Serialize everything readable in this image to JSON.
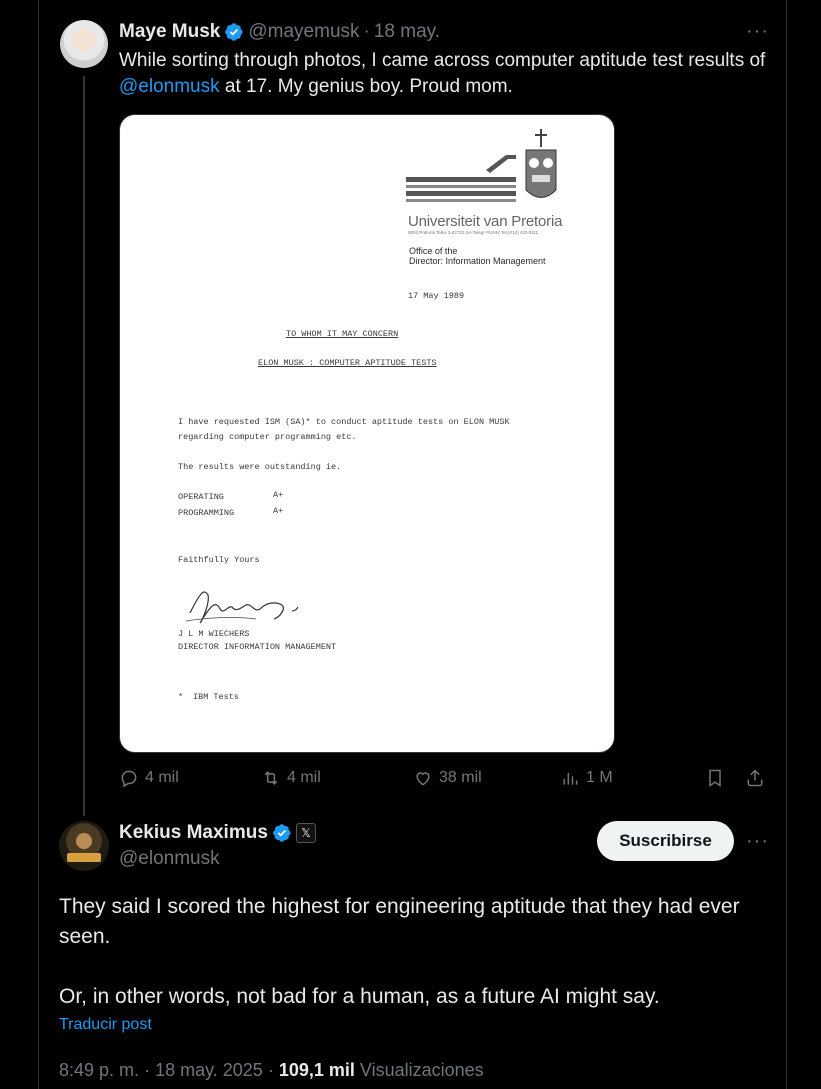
{
  "colors": {
    "background": "#000000",
    "accent": "#1d9bf0",
    "muted": "#71767b",
    "text": "#e7e9ea",
    "verified": "#1d9bf0"
  },
  "original_post": {
    "author_name": "Maye Musk",
    "author_handle": "@mayemusk",
    "separator": "·",
    "date": "18 may.",
    "more_icon": "more-horizontal-icon",
    "text_before": "While sorting through photos, I came across computer aptitude test results of ",
    "mention": "@elonmusk",
    "text_after": " at 17. My genius boy. Proud mom.",
    "image": {
      "letterhead_name": "Universiteit van Pretoria",
      "letterhead_small": "0002 Pretoria Telex 3-22723 SA Telegr PUNIV Tel (012) 420-9111",
      "office_line1": "Office of the",
      "office_line2": "Director: Information Management",
      "date": "17 May 1989",
      "heading1": "TO WHOM IT MAY CONCERN",
      "heading2": "ELON MUSK : COMPUTER APTITUDE TESTS",
      "body_line1": "I have requested ISM (SA)* to conduct aptitude tests on ELON MUSK",
      "body_line2": "regarding computer programming etc.",
      "body_line3": "The results were outstanding ie.",
      "result1_label": "OPERATING",
      "result1_grade": "A+",
      "result2_label": "PROGRAMMING",
      "result2_grade": "A+",
      "closing": "Faithfully Yours",
      "signer": "J L M WIECHERS",
      "signer_title": "DIRECTOR INFORMATION MANAGEMENT",
      "footnote_mark": "*",
      "footnote": "IBM Tests"
    },
    "actions": {
      "replies": "4 mil",
      "reposts": "4 mil",
      "likes": "38 mil",
      "views": "1 M"
    }
  },
  "reply_post": {
    "author_name": "Kekius Maximus",
    "author_handle": "@elonmusk",
    "affiliate_badge": "𝕏",
    "subscribe_label": "Suscribirse",
    "paragraph1": "They said I scored the highest for engineering aptitude that they had ever seen.",
    "paragraph2": "Or, in other words, not bad for a human, as a future AI might say.",
    "translate_label": "Traducir post",
    "time": "8:49 p. m.",
    "date": "18 may. 2025",
    "views_count": "109,1 mil",
    "views_label": "Visualizaciones"
  }
}
